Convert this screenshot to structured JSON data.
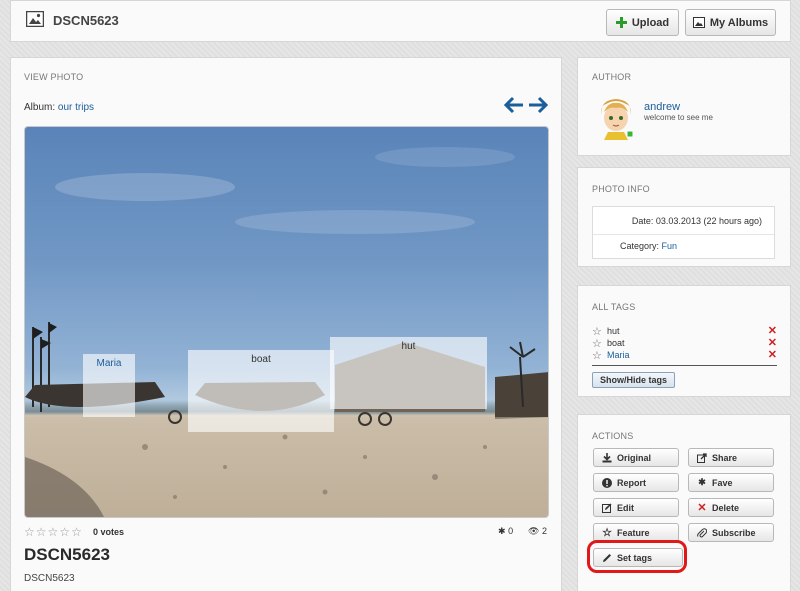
{
  "header": {
    "title": "DSCN5623",
    "upload_label": "Upload",
    "albums_label": "My Albums"
  },
  "view_photo": {
    "section_title": "VIEW PHOTO",
    "album_prefix": "Album:",
    "album_name": "our trips",
    "photo_tags": [
      {
        "label": "Maria"
      },
      {
        "label": "boat"
      },
      {
        "label": "hut"
      }
    ],
    "votes": "0 votes",
    "rating_stars": 0,
    "fave_count": "0",
    "view_count": "2",
    "title": "DSCN5623",
    "description": "DSCN5623"
  },
  "author": {
    "section_title": "AUTHOR",
    "name": "andrew",
    "status": "welcome to see me",
    "online_color": "#3cb43c"
  },
  "photo_info": {
    "section_title": "PHOTO INFO",
    "date_label": "Date:",
    "date_value": "03.03.2013 (22 hours ago)",
    "category_label": "Category:",
    "category_value": "Fun"
  },
  "all_tags": {
    "section_title": "ALL TAGS",
    "tags": [
      "hut",
      "boat",
      "Maria"
    ],
    "show_hide_label": "Show/Hide tags"
  },
  "actions": {
    "section_title": "ACTIONS",
    "original": "Original",
    "share": "Share",
    "report": "Report",
    "fave": "Fave",
    "edit": "Edit",
    "delete": "Delete",
    "feature": "Feature",
    "subscribe": "Subscribe",
    "set_tags": "Set tags"
  },
  "colors": {
    "link": "#1a5e9a",
    "remove": "#d02020",
    "upload_plus": "#2a9a2a",
    "highlight": "#e01818"
  }
}
